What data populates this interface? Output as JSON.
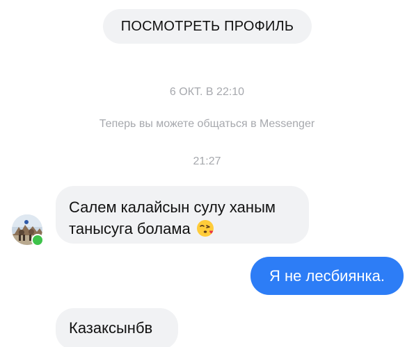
{
  "header": {
    "view_profile_label": "ПОСМОТРЕТЬ ПРОФИЛЬ"
  },
  "thread": {
    "date_separator": "6 ОКТ. В 22:10",
    "system_notice": "Теперь вы можете общаться в Messenger",
    "time_separator": "21:27",
    "messages": [
      {
        "direction": "incoming",
        "line1": "Салем калайсын сулу ханым",
        "line2": "танысуга болама",
        "emoji": "face-blowing-kiss-icon"
      },
      {
        "direction": "outgoing",
        "text": "Я не лесбиянка."
      },
      {
        "direction": "incoming",
        "text": "Казаксынбв"
      }
    ]
  },
  "contact": {
    "online": true
  },
  "colors": {
    "outgoing_bubble": "#2d7df6",
    "incoming_bubble": "#f1f2f4",
    "meta_text": "#a6a8ad",
    "online_dot": "#3ec34b"
  }
}
